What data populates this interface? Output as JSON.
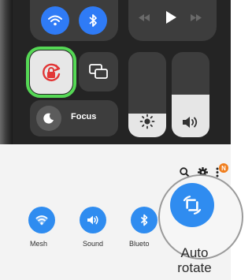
{
  "ios_control_center": {
    "tiles": {
      "wifi_icon": "wifi-icon",
      "bluetooth_icon": "bluetooth-icon",
      "media_icons": [
        "previous-icon",
        "play-icon",
        "next-icon"
      ],
      "rotation_lock_icon": "rotation-lock-icon",
      "screen_mirroring_icon": "screen-mirroring-icon",
      "focus_label": "Focus",
      "brightness_level": 0.28,
      "volume_level": 0.5
    },
    "colors": {
      "accent": "#2f7bf6",
      "highlight": "#55d855"
    }
  },
  "android_quick_settings": {
    "top_icons": [
      "search-icon",
      "gear-icon"
    ],
    "notification_badge": "N",
    "tiles": [
      {
        "label": "Mesh",
        "icon": "wifi-icon"
      },
      {
        "label": "Sound",
        "icon": "volume-icon"
      },
      {
        "label": "Blueto",
        "icon": "bluetooth-icon"
      }
    ],
    "magnified_tile": {
      "line1": "Auto",
      "line2": "rotate",
      "icon": "auto-rotate-icon"
    },
    "colors": {
      "accent": "#2f8cf0"
    }
  }
}
